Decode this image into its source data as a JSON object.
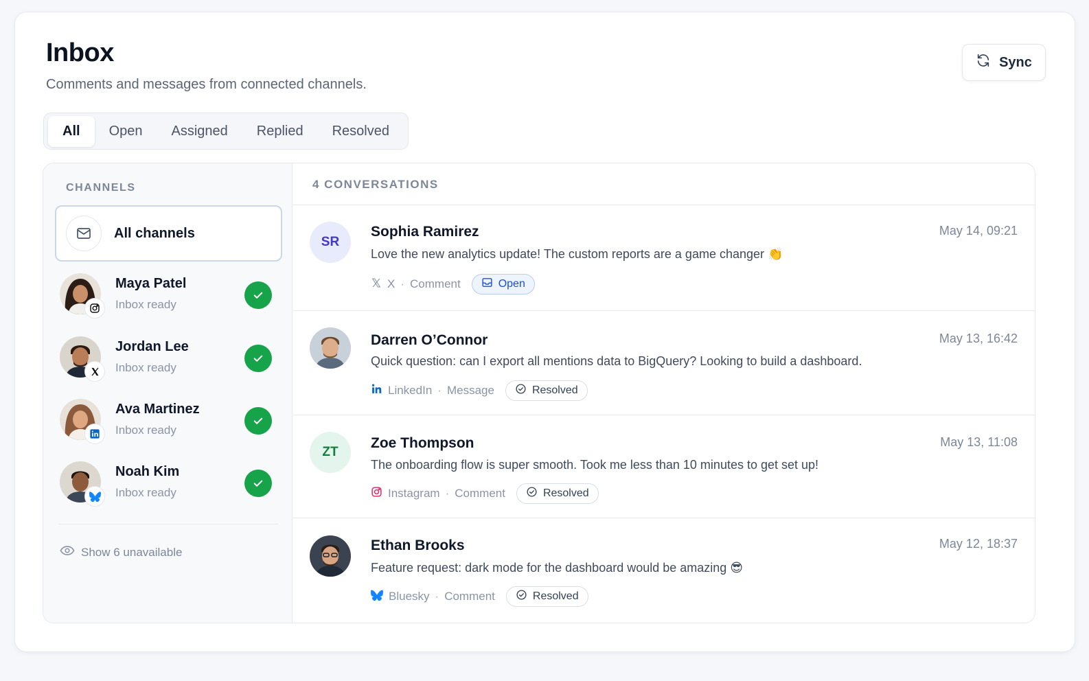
{
  "header": {
    "title": "Inbox",
    "subtitle": "Comments and messages from connected channels.",
    "sync_label": "Sync"
  },
  "tabs": [
    {
      "label": "All",
      "active": true
    },
    {
      "label": "Open",
      "active": false
    },
    {
      "label": "Assigned",
      "active": false
    },
    {
      "label": "Replied",
      "active": false
    },
    {
      "label": "Resolved",
      "active": false
    }
  ],
  "sidebar": {
    "heading": "CHANNELS",
    "all_channels_label": "All channels",
    "accounts": [
      {
        "name": "Maya Patel",
        "status": "Inbox ready",
        "network": "instagram-icon"
      },
      {
        "name": "Jordan Lee",
        "status": "Inbox ready",
        "network": "x-icon"
      },
      {
        "name": "Ava Martinez",
        "status": "Inbox ready",
        "network": "linkedin-icon"
      },
      {
        "name": "Noah Kim",
        "status": "Inbox ready",
        "network": "bluesky-icon"
      }
    ],
    "show_unavailable": "Show 6 unavailable"
  },
  "conversations": {
    "count_label": "4 CONVERSATIONS",
    "items": [
      {
        "initials": "SR",
        "name": "Sophia Ramirez",
        "time": "May 14, 09:21",
        "text": "Love the new analytics update! The custom reports are a game changer 👏",
        "network": "X",
        "kind": "Comment",
        "status": "Open"
      },
      {
        "initials": "",
        "name": "Darren O’Connor",
        "time": "May 13, 16:42",
        "text": "Quick question: can I export all mentions data to BigQuery? Looking to build a dashboard.",
        "network": "LinkedIn",
        "kind": "Message",
        "status": "Resolved"
      },
      {
        "initials": "ZT",
        "name": "Zoe Thompson",
        "time": "May 13, 11:08",
        "text": "The onboarding flow is super smooth. Took me less than 10 minutes to get set up!",
        "network": "Instagram",
        "kind": "Comment",
        "status": "Resolved"
      },
      {
        "initials": "",
        "name": "Ethan Brooks",
        "time": "May 12, 18:37",
        "text": "Feature request: dark mode for the dashboard would be amazing 😎",
        "network": "Bluesky",
        "kind": "Comment",
        "status": "Resolved"
      }
    ]
  },
  "colors": {
    "accent": "#1d4ed8",
    "success": "#16a34a",
    "linkedin": "#0a66c2",
    "bluesky": "#1185fe",
    "instagram": "#e1306c"
  }
}
